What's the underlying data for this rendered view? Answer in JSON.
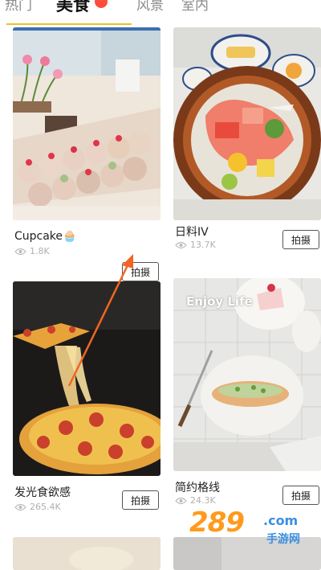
{
  "tabs": [
    {
      "label": "热门"
    },
    {
      "label": "美食"
    },
    {
      "label": "风景"
    },
    {
      "label": "室内"
    }
  ],
  "cards": [
    {
      "title": "Cupcake🧁",
      "views": "1.8K",
      "shoot_label": "拍摄"
    },
    {
      "title": "日料IV",
      "views": "13.7K",
      "shoot_label": "拍摄"
    },
    {
      "title": "发光食欲感",
      "views": "265.4K",
      "shoot_label": "拍摄"
    },
    {
      "title": "简约格线",
      "views": "24.3K",
      "shoot_label": "拍摄",
      "overlay_text": "Enjoy Life"
    }
  ],
  "watermark": {
    "number": "289",
    "domain": ".com",
    "site": "手游网"
  },
  "colors": {
    "accent_underline": "#e9c320",
    "hot_dot": "#ff4d3d",
    "arrow": "#f26522"
  }
}
